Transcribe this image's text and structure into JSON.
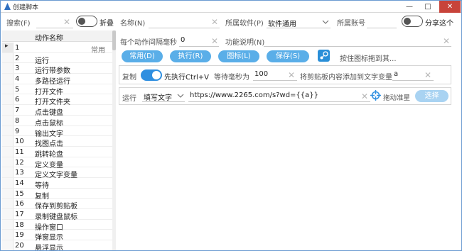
{
  "window": {
    "title": "创建脚本"
  },
  "toolbar": {
    "search_label": "搜索(F)",
    "fold_label": "折叠",
    "name_label": "名称(N)",
    "software_label": "所属软件(P)",
    "software_value": "软件通用",
    "account_label": "所属账号",
    "share_label": "分享这个"
  },
  "settings": {
    "interval_label": "每个动作间隔毫秒",
    "interval_value": "0",
    "desc_label": "功能说明(N)"
  },
  "buttons": {
    "common": "常用(D)",
    "execute": "执行(R)",
    "icon": "图标(L)",
    "save": "保存(S)",
    "drag_hint": "按住图标拖到其..."
  },
  "list": {
    "header": "动作名称",
    "items": [
      {
        "num": "1",
        "name": "",
        "cat": "常用"
      },
      {
        "num": "2",
        "name": "运行",
        "cat": ""
      },
      {
        "num": "3",
        "name": "运行带参数",
        "cat": ""
      },
      {
        "num": "4",
        "name": "多路径运行",
        "cat": ""
      },
      {
        "num": "5",
        "name": "打开文件",
        "cat": ""
      },
      {
        "num": "6",
        "name": "打开文件夹",
        "cat": ""
      },
      {
        "num": "7",
        "name": "点击键盘",
        "cat": ""
      },
      {
        "num": "8",
        "name": "点击鼠标",
        "cat": ""
      },
      {
        "num": "9",
        "name": "输出文字",
        "cat": ""
      },
      {
        "num": "10",
        "name": "找图点击",
        "cat": ""
      },
      {
        "num": "11",
        "name": "跳转轮盘",
        "cat": ""
      },
      {
        "num": "12",
        "name": "定义变量",
        "cat": ""
      },
      {
        "num": "13",
        "name": "定义文字变量",
        "cat": ""
      },
      {
        "num": "14",
        "name": "等待",
        "cat": ""
      },
      {
        "num": "15",
        "name": "复制",
        "cat": ""
      },
      {
        "num": "16",
        "name": "保存到剪贴板",
        "cat": ""
      },
      {
        "num": "17",
        "name": "录制键盘鼠标",
        "cat": ""
      },
      {
        "num": "18",
        "name": "操作窗口",
        "cat": ""
      },
      {
        "num": "19",
        "name": "弹窗显示",
        "cat": ""
      },
      {
        "num": "20",
        "name": "悬浮显示",
        "cat": ""
      }
    ]
  },
  "copy_step": {
    "label": "复制",
    "first_exec_label": "先执行Ctrl+V",
    "wait_label": "等待毫秒为",
    "wait_value": "100",
    "clipboard_label": "将剪贴板内容添加到文字变量",
    "var_value": "a"
  },
  "run_step": {
    "label": "运行",
    "mode_value": "填写文字",
    "url_value": "https://www.2265.com/s?wd={{a}}",
    "drag_label": "拖动准星",
    "select_button": "选择"
  },
  "colors": {
    "accent": "#2f8fe0",
    "button": "#5aaee8",
    "close": "#c8433a"
  }
}
